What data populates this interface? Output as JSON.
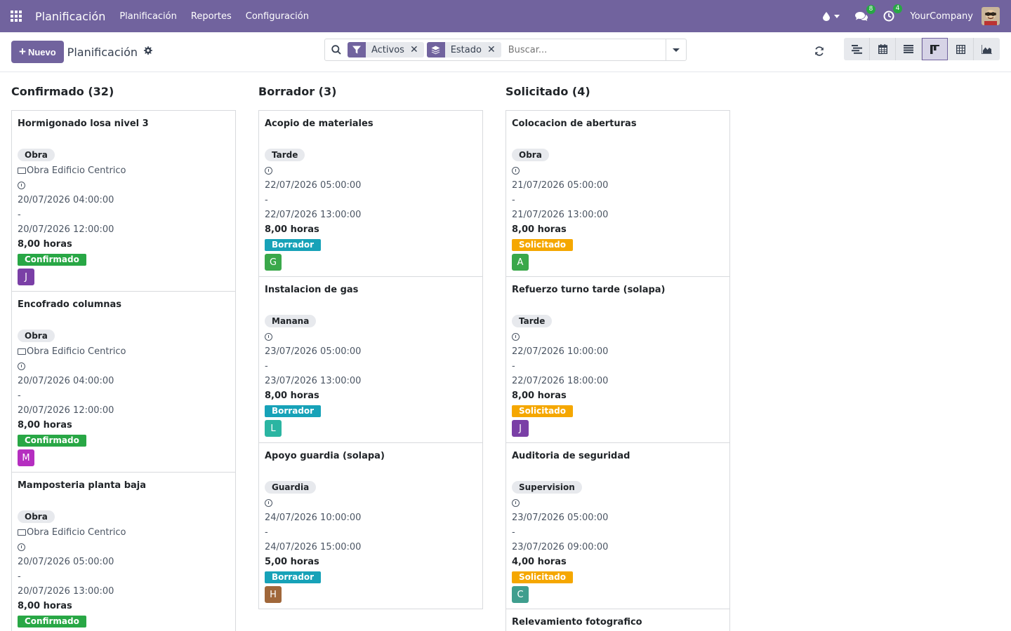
{
  "navbar": {
    "brand": "Planificación",
    "menus": [
      "Planificación",
      "Reportes",
      "Configuración"
    ],
    "messages_count": "8",
    "activities_count": "4",
    "company": "YourCompany",
    "accent": "#71639e"
  },
  "control_panel": {
    "new_label": "Nuevo",
    "title": "Planificación",
    "facets": [
      "Activos",
      "Estado"
    ],
    "search_placeholder": "Buscar..."
  },
  "columns": [
    {
      "header": "Confirmado (32)",
      "cards": [
        {
          "title": "Hormigonado losa nivel 3",
          "tag": "Obra",
          "project": "Obra Edificio Centrico",
          "start": "20/07/2026 04:00:00",
          "sep": "-",
          "end": "20/07/2026 12:00:00",
          "hours": "8,00 horas",
          "state": "Confirmado",
          "state_color": "#28a745",
          "avatar": "J",
          "avatar_color": "#7a3fa6"
        },
        {
          "title": "Encofrado columnas",
          "tag": "Obra",
          "project": "Obra Edificio Centrico",
          "start": "20/07/2026 04:00:00",
          "sep": "-",
          "end": "20/07/2026 12:00:00",
          "hours": "8,00 horas",
          "state": "Confirmado",
          "state_color": "#28a745",
          "avatar": "M",
          "avatar_color": "#b52ec0"
        },
        {
          "title": "Mamposteria planta baja",
          "tag": "Obra",
          "project": "Obra Edificio Centrico",
          "start": "20/07/2026 05:00:00",
          "sep": "-",
          "end": "20/07/2026 13:00:00",
          "hours": "8,00 horas",
          "state": "Confirmado",
          "state_color": "#28a745",
          "avatar": "",
          "avatar_color": "#7a3fa6"
        }
      ]
    },
    {
      "header": "Borrador (3)",
      "cards": [
        {
          "title": "Acopio de materiales",
          "tag": "Tarde",
          "project": "",
          "start": "22/07/2026 05:00:00",
          "sep": "-",
          "end": "22/07/2026 13:00:00",
          "hours": "8,00 horas",
          "state": "Borrador",
          "state_color": "#17a2b8",
          "avatar": "G",
          "avatar_color": "#3aa84a"
        },
        {
          "title": "Instalacion de gas",
          "tag": "Manana",
          "project": "",
          "start": "23/07/2026 05:00:00",
          "sep": "-",
          "end": "23/07/2026 13:00:00",
          "hours": "8,00 horas",
          "state": "Borrador",
          "state_color": "#17a2b8",
          "avatar": "L",
          "avatar_color": "#2bb5a2"
        },
        {
          "title": "Apoyo guardia (solapa)",
          "tag": "Guardia",
          "project": "",
          "start": "24/07/2026 10:00:00",
          "sep": "-",
          "end": "24/07/2026 15:00:00",
          "hours": "5,00 horas",
          "state": "Borrador",
          "state_color": "#17a2b8",
          "avatar": "H",
          "avatar_color": "#a0673a"
        }
      ]
    },
    {
      "header": "Solicitado (4)",
      "cards": [
        {
          "title": "Colocacion de aberturas",
          "tag": "Obra",
          "project": "",
          "start": "21/07/2026 05:00:00",
          "sep": "-",
          "end": "21/07/2026 13:00:00",
          "hours": "8,00 horas",
          "state": "Solicitado",
          "state_color": "#f5a700",
          "avatar": "A",
          "avatar_color": "#3aa84a"
        },
        {
          "title": "Refuerzo turno tarde (solapa)",
          "tag": "Tarde",
          "project": "",
          "start": "22/07/2026 10:00:00",
          "sep": "-",
          "end": "22/07/2026 18:00:00",
          "hours": "8,00 horas",
          "state": "Solicitado",
          "state_color": "#f5a700",
          "avatar": "J",
          "avatar_color": "#7a3fa6"
        },
        {
          "title": "Auditoria de seguridad",
          "tag": "Supervision",
          "project": "",
          "start": "23/07/2026 05:00:00",
          "sep": "-",
          "end": "23/07/2026 09:00:00",
          "hours": "4,00 horas",
          "state": "Solicitado",
          "state_color": "#f5a700",
          "avatar": "C",
          "avatar_color": "#3f9e8e"
        },
        {
          "title": "Relevamiento fotografico",
          "tag": "",
          "project": "",
          "start": "",
          "sep": "",
          "end": "",
          "hours": "",
          "state": "",
          "state_color": "#f5a700",
          "avatar": "",
          "avatar_color": "#7a3fa6"
        }
      ]
    }
  ]
}
